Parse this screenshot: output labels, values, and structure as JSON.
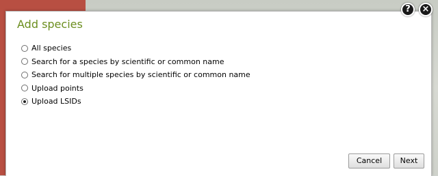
{
  "dialog": {
    "title": "Add species",
    "options": [
      {
        "label": "All species",
        "selected": false
      },
      {
        "label": "Search for a species by scientific or common name",
        "selected": false
      },
      {
        "label": "Search for multiple species by scientific or common name",
        "selected": false
      },
      {
        "label": "Upload points",
        "selected": false
      },
      {
        "label": "Upload LSIDs",
        "selected": true
      }
    ],
    "buttons": {
      "cancel": "Cancel",
      "next": "Next"
    }
  },
  "header_icons": {
    "help": "?",
    "close": "×"
  }
}
